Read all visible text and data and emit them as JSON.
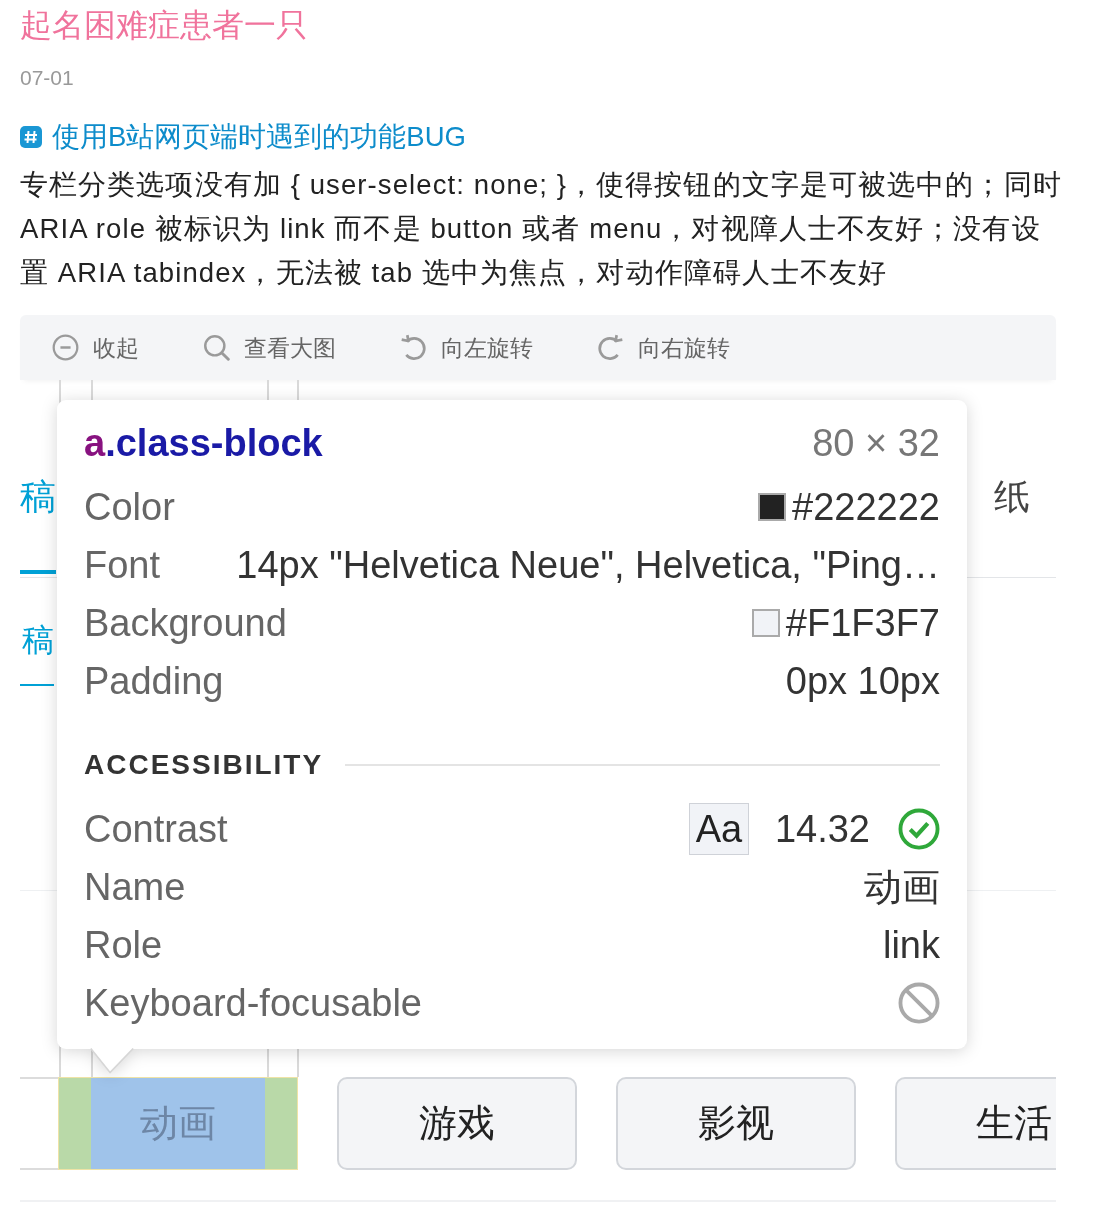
{
  "post": {
    "author": "起名困难症患者一只",
    "date": "07-01",
    "topic": "使用B站网页端时遇到的功能BUG",
    "body": "专栏分类选项没有加 { user-select: none; }，使得按钮的文字是可被选中的；同时 ARIA role 被标识为 link 而不是 button 或者 menu，对视障人士不友好；没有设置 ARIA tabindex，无法被 tab 选中为焦点，对动作障碍人士不友好"
  },
  "image_toolbar": [
    {
      "kind": "collapse",
      "label": "收起"
    },
    {
      "kind": "zoom",
      "label": "查看大图"
    },
    {
      "kind": "rotate_left",
      "label": "向左旋转"
    },
    {
      "kind": "rotate_right",
      "label": "向右旋转"
    }
  ],
  "screenshot": {
    "page_tabs": [
      {
        "label": "稿",
        "selected": true
      },
      {
        "label": "纸",
        "selected": false
      }
    ],
    "sub_tabs": [
      {
        "label": "稿",
        "selected": true
      }
    ],
    "inspector": {
      "tag": "a",
      "class_name": ".class-block",
      "size": "80 × 32",
      "properties": [
        {
          "kind": "color",
          "label": "Color",
          "value": "#222222",
          "color": "#222222"
        },
        {
          "kind": "text",
          "label": "Font",
          "value": "14px \"Helvetica Neue\", Helvetica, \"Ping…"
        },
        {
          "kind": "color",
          "label": "Background",
          "value": "#F1F3F7",
          "color": "#f1f3f7"
        },
        {
          "kind": "text",
          "label": "Padding",
          "value": "0px 10px"
        }
      ],
      "section_title": "ACCESSIBILITY",
      "accessibility": [
        {
          "kind": "contrast",
          "label": "Contrast",
          "sample": "Aa",
          "value": "14.32",
          "passes": true
        },
        {
          "kind": "text",
          "label": "Name",
          "value": "动画"
        },
        {
          "kind": "text",
          "label": "Role",
          "value": "link"
        },
        {
          "kind": "focusable",
          "label": "Keyboard-focusable",
          "focusable": false
        }
      ]
    },
    "category_buttons": [
      {
        "label": "动画",
        "highlighted": true
      },
      {
        "label": "游戏",
        "highlighted": false
      },
      {
        "label": "影视",
        "highlighted": false
      },
      {
        "label": "生活",
        "highlighted": false
      }
    ]
  }
}
